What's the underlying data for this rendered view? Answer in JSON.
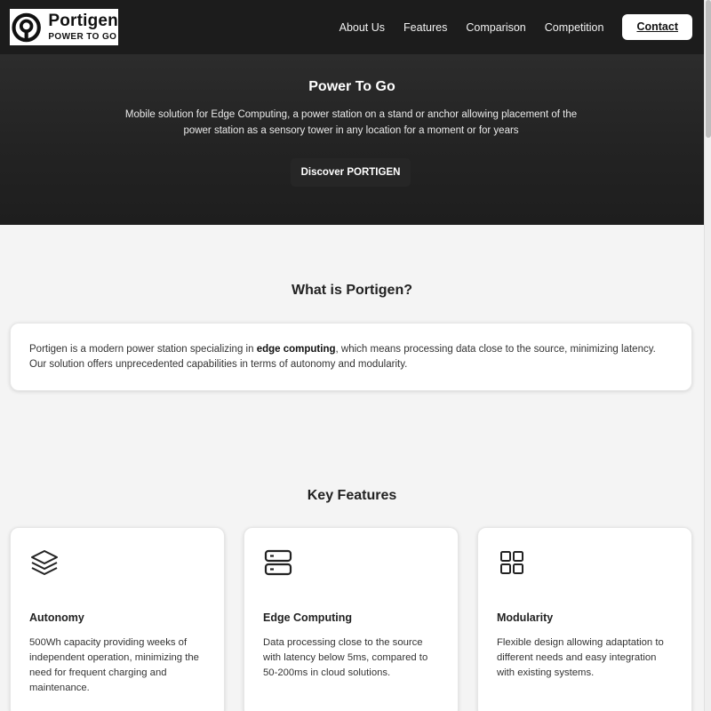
{
  "brand": {
    "name": "Portigen",
    "tagline": "POWER TO GO"
  },
  "nav": {
    "items": [
      "About Us",
      "Features",
      "Comparison",
      "Competition"
    ],
    "contact": "Contact"
  },
  "hero": {
    "title": "Power To Go",
    "subtitle": "Mobile solution for Edge Computing, a power station on a stand or anchor allowing placement of the power station as a sensory tower in any location for a moment or for years",
    "button": "Discover PORTIGEN"
  },
  "about": {
    "title": "What is Portigen?",
    "text_before": "Portigen is a modern power station specializing in ",
    "text_bold": "edge computing",
    "text_after": ", which means processing data close to the source, minimizing latency. Our solution offers unprecedented capabilities in terms of autonomy and modularity."
  },
  "features": {
    "title": "Key Features",
    "items": [
      {
        "icon": "layers-icon",
        "title": "Autonomy",
        "text": "500Wh capacity providing weeks of independent operation, minimizing the need for frequent charging and maintenance."
      },
      {
        "icon": "server-icon",
        "title": "Edge Computing",
        "text": "Data processing close to the source with latency below 5ms, compared to 50-200ms in cloud solutions."
      },
      {
        "icon": "grid-icon",
        "title": "Modularity",
        "text": "Flexible design allowing adaptation to different needs and easy integration with existing systems."
      }
    ]
  },
  "colors": {
    "header": "#1c1c1c",
    "hero": "#262626",
    "page": "#f4f4f4",
    "card": "#ffffff"
  }
}
